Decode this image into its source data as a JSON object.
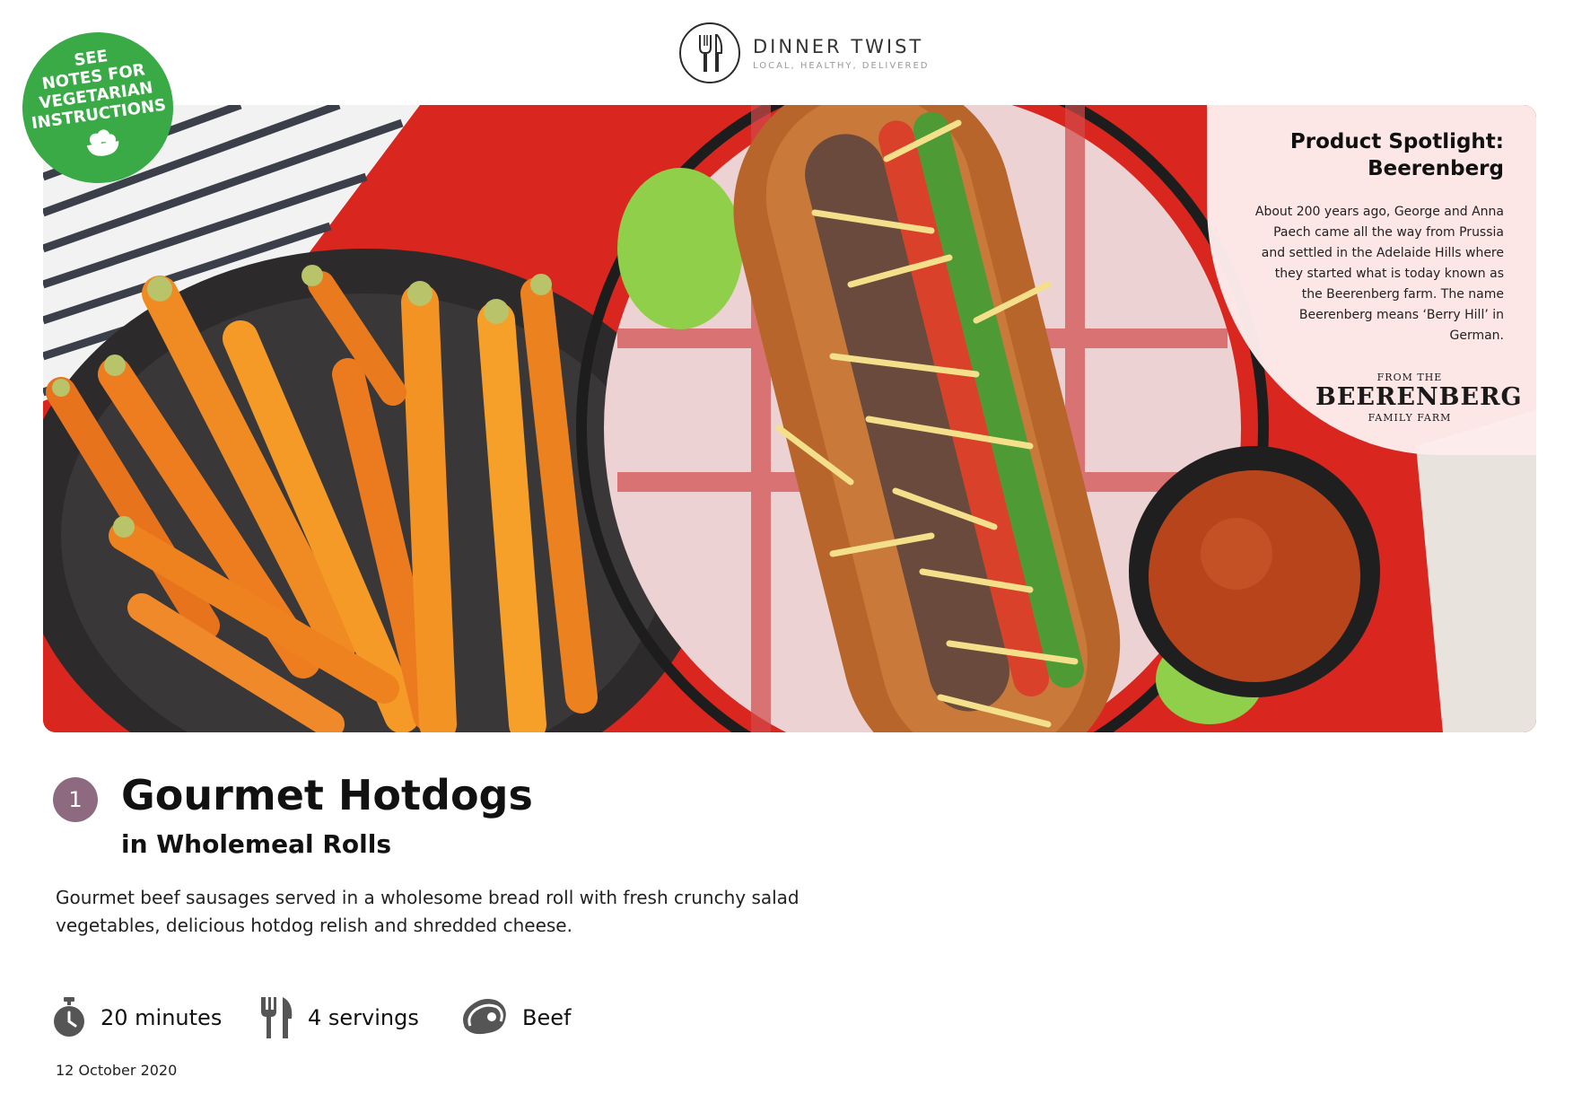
{
  "brand": {
    "name": "DINNER TWIST",
    "tagline": "LOCAL, HEALTHY, DELIVERED",
    "icon": "fork-knife-icon"
  },
  "badge": {
    "lines": [
      "SEE",
      "NOTES FOR",
      "VEGETARIAN",
      "INSTRUCTIONS"
    ],
    "icon": "salad-bowl-icon",
    "color": "#3aaa47"
  },
  "hero": {
    "icon": "hotdog-carrots-photo"
  },
  "spotlight": {
    "title_line1": "Product Spotlight:",
    "title_line2": "Beerenberg",
    "body": "About 200 years ago, George and Anna Paech came all the way from Prussia and settled in the Adelaide Hills where they started what is today known as the Beerenberg farm. The name Beerenberg means ‘Berry Hill’ in German.",
    "logo_from": "FROM THE",
    "logo_name": "BEERENBERG",
    "logo_farm": "FAMILY FARM"
  },
  "recipe": {
    "step": "1",
    "step_color": "#8e6a80",
    "title": "Gourmet Hotdogs",
    "subtitle": "in Wholemeal Rolls",
    "description": "Gourmet beef sausages served in a wholesome bread roll with fresh crunchy salad vegetables, delicious hotdog relish and shredded cheese."
  },
  "meta": {
    "time": "20 minutes",
    "time_icon": "stopwatch-icon",
    "servings": "4 servings",
    "servings_icon": "fork-knife-icon",
    "protein": "Beef",
    "protein_icon": "steak-icon"
  },
  "date": "12 October 2020"
}
